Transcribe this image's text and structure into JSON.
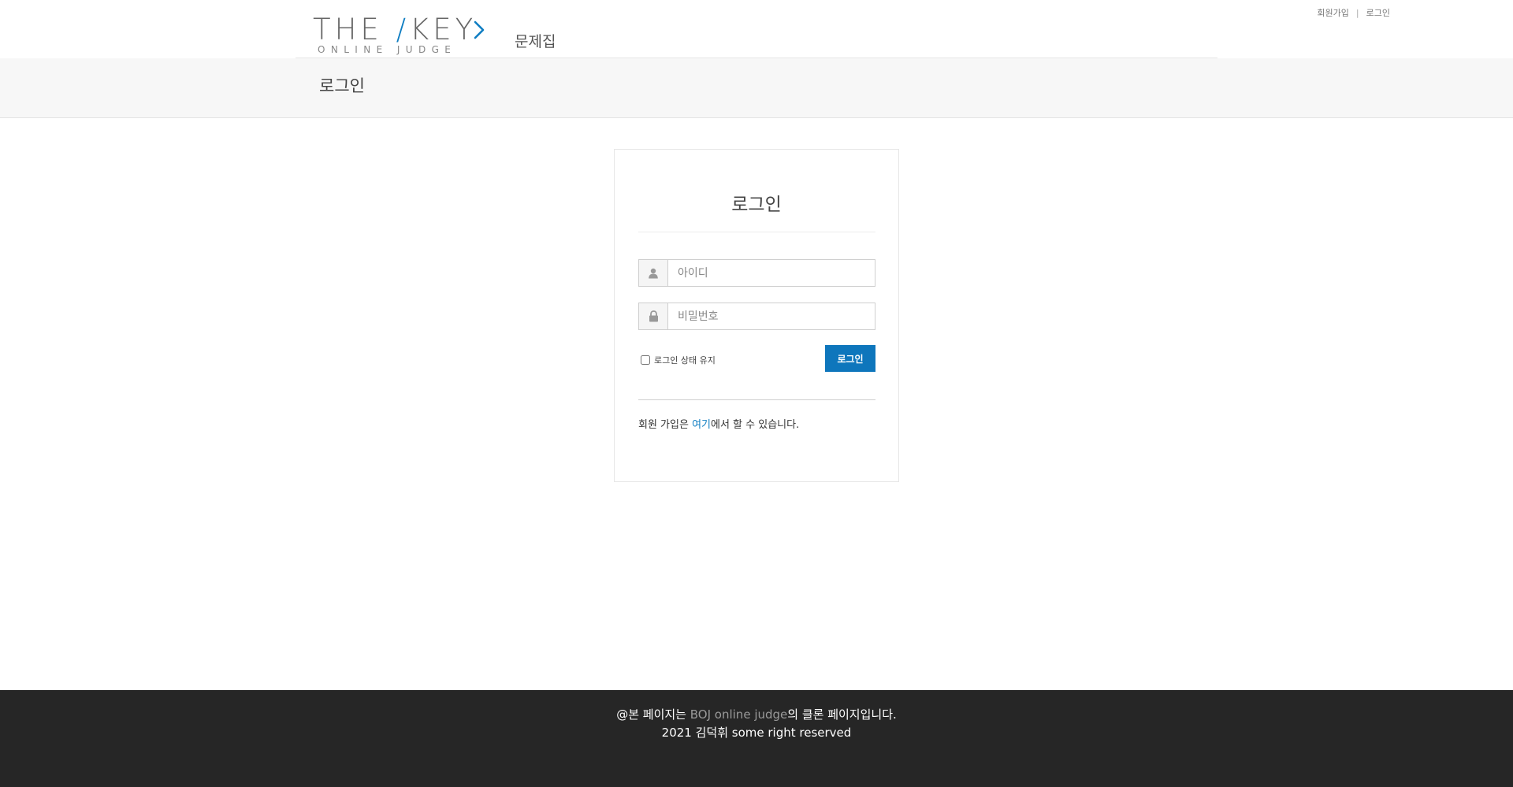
{
  "header": {
    "logo": {
      "main_prefix": "THE ",
      "main_accent": "/",
      "main_suffix": "KEY",
      "sub": "ONLINE JUDGE"
    },
    "nav_problems": "문제집",
    "top_links": {
      "signup": "회원가입",
      "separator": "|",
      "login": "로그인"
    }
  },
  "page_title": "로그인",
  "login_panel": {
    "title": "로그인",
    "id_field": {
      "placeholder": "아이디",
      "value": ""
    },
    "password_field": {
      "placeholder": "비밀번호",
      "value": ""
    },
    "remember_label": "로그인 상태 유지",
    "submit_label": "로그인",
    "signup_prefix": "회원 가입은 ",
    "signup_link": "여기",
    "signup_suffix": "에서 할 수 있습니다."
  },
  "footer": {
    "line1_prefix": "@본 페이지는 ",
    "line1_link": "BOJ online judge",
    "line1_suffix": "의 클론 페이지입니다.",
    "line2": "2021 김덕휘 some right reserved"
  },
  "colors": {
    "accent": "#0e7dc2",
    "button": "#0e76bc",
    "footer_bg": "#262626",
    "title_band_bg": "#f7f7f7"
  },
  "icons": {
    "id_field": "user-icon",
    "password_field": "lock-icon",
    "logo_arrow": "chevron-right-icon"
  }
}
